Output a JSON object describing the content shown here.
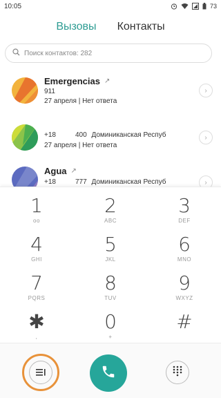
{
  "status_bar": {
    "time": "10:05",
    "battery": "73"
  },
  "tabs": {
    "calls": "Вызовы",
    "contacts": "Контакты"
  },
  "search": {
    "placeholder": "Поиск контактов: 282"
  },
  "calls": [
    {
      "name": "Emergencias",
      "number": "911",
      "meta": "27 апреля | Нет ответа",
      "avatar_colors": [
        "#f2b33d",
        "#e8742e"
      ]
    },
    {
      "name": "",
      "number_prefix": "+18",
      "number_suffix": "400",
      "location": "Доминиканская Респуб",
      "meta": "27 апреля | Нет ответа",
      "avatar_colors": [
        "#8bc34a",
        "#2e9c5a"
      ]
    },
    {
      "name": "Agua",
      "number_prefix": "+18",
      "number_suffix": "777",
      "location": "Доминиканская Респуб",
      "meta": "",
      "avatar_colors": [
        "#5c6bc0",
        "#8e7cc3"
      ]
    }
  ],
  "dialpad": {
    "keys": [
      {
        "digit": "1",
        "letters": "ᴏᴏ"
      },
      {
        "digit": "2",
        "letters": "ABC"
      },
      {
        "digit": "3",
        "letters": "DEF"
      },
      {
        "digit": "4",
        "letters": "GHI"
      },
      {
        "digit": "5",
        "letters": "JKL"
      },
      {
        "digit": "6",
        "letters": "MNO"
      },
      {
        "digit": "7",
        "letters": "PQRS"
      },
      {
        "digit": "8",
        "letters": "TUV"
      },
      {
        "digit": "9",
        "letters": "WXYZ"
      },
      {
        "digit": "✱",
        "letters": ","
      },
      {
        "digit": "0",
        "letters": "+"
      },
      {
        "digit": "#",
        "letters": ""
      }
    ]
  },
  "bottom_bar": {
    "icons": [
      "menu-icon",
      "phone-icon",
      "dialpad-grid-icon"
    ],
    "highlight_color": "#e8923a",
    "call_color": "#26a69a"
  }
}
